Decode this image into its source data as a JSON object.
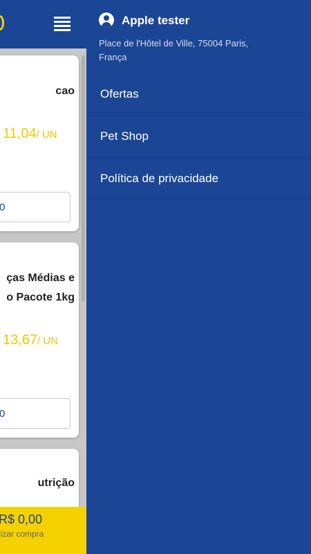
{
  "background_page": {
    "header": {
      "menu_icon": "hamburger-menu-icon"
    },
    "products": [
      {
        "name": "cao",
        "price": "11,04",
        "unit": "/ UN",
        "quantity": "0"
      },
      {
        "name": "ças Médias e\no Pacote 1kg",
        "price": "13,67",
        "unit": "/ UN",
        "quantity": "0"
      },
      {
        "name": "utrição"
      }
    ],
    "cart": {
      "total": "R$ 0,00",
      "hint": "lizar compra"
    }
  },
  "drawer": {
    "user": {
      "icon": "account-circle-icon",
      "name": "Apple tester",
      "address": "Place de l'Hôtel de Ville, 75004 Paris, França"
    },
    "menu": [
      "Ofertas",
      "Pet Shop",
      "Política de privacidade"
    ]
  },
  "colors": {
    "brand_blue": "#1b4595",
    "accent_yellow": "#f5d100",
    "price_yellow": "#f0c800"
  }
}
